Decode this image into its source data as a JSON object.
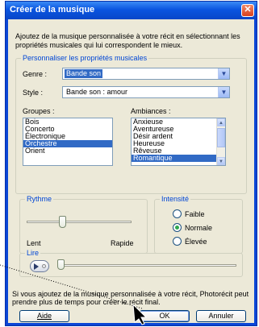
{
  "window": {
    "title": "Créer de la musique"
  },
  "intro": "Ajoutez de la musique personnalisée à votre récit en sélectionnant les propriétés musicales qui lui correspondent le mieux.",
  "props_group": {
    "legend": "Personnaliser les propriétés musicales"
  },
  "genre": {
    "label": "Genre :",
    "value": "Bande son"
  },
  "style": {
    "label": "Style :",
    "value": "Bande son : amour"
  },
  "groupes": {
    "label": "Groupes :",
    "items": [
      "Bois",
      "Concerto",
      "Électronique",
      "Orchestre",
      "Orient"
    ],
    "selected_index": 3
  },
  "ambiances": {
    "label": "Ambiances :",
    "items": [
      "Anxieuse",
      "Aventureuse",
      "Désir ardent",
      "Heureuse",
      "Rêveuse",
      "Romantique"
    ],
    "selected_index": 5
  },
  "rythme": {
    "legend": "Rythme",
    "slow": "Lent",
    "fast": "Rapide",
    "level": 0.33
  },
  "intensite": {
    "legend": "Intensité",
    "options": [
      "Faible",
      "Normale",
      "Élevée"
    ],
    "selected_index": 1
  },
  "lire": {
    "legend": "Lire",
    "progress": 0.0
  },
  "footer_note": "Si vous ajoutez de la musique personnalisée à votre récit, Photorécit peut prendre plus de temps pour créer le récit final.",
  "buttons": {
    "help": "Aide",
    "ok": "OK",
    "cancel": "Annuler"
  },
  "icons": {
    "close": "close-icon",
    "dropdown": "chevron-down-icon",
    "play": "play-icon",
    "cursor": "arrow-cursor-icon"
  }
}
